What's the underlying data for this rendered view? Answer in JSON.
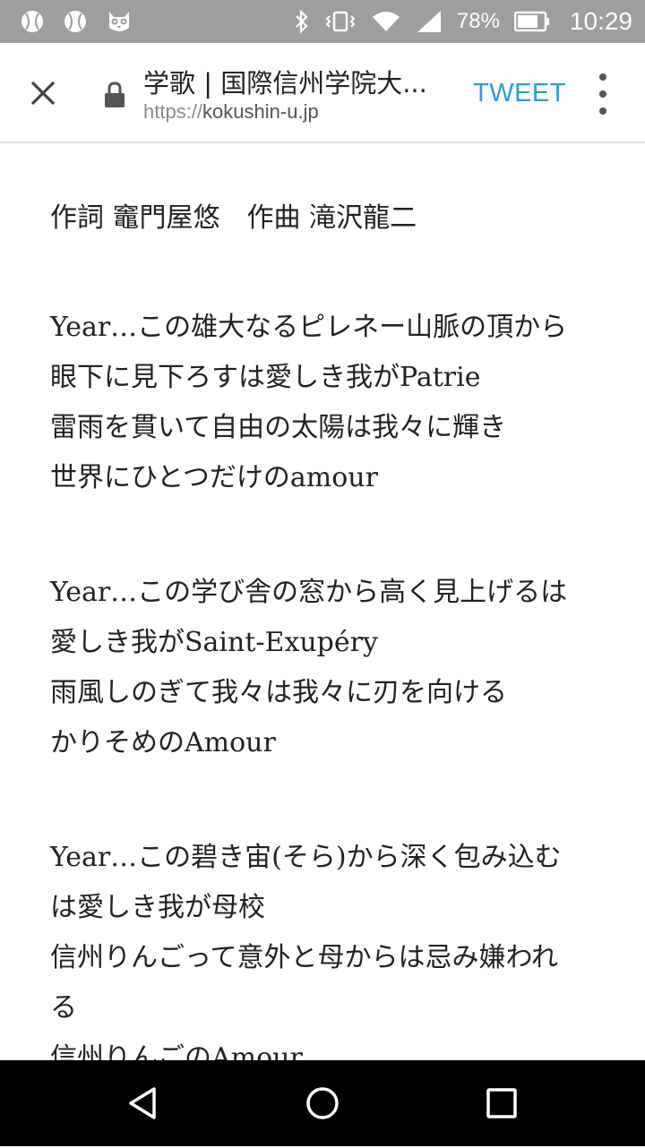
{
  "status_bar": {
    "battery_percent": "78%",
    "time": "10:29",
    "left_icons": [
      "baseball-icon",
      "baseball-icon",
      "owl-icon"
    ],
    "right_icons": [
      "bluetooth-icon",
      "vibrate-icon",
      "wifi-icon",
      "signal-icon",
      "battery-icon"
    ]
  },
  "toolbar": {
    "title": "学歌 | 国際信州学院大...",
    "url_scheme": "https://",
    "url_host": "kokushin-u.jp",
    "tweet_label": "TWEET"
  },
  "content": {
    "credit": "作詞 竈門屋悠　作曲 滝沢龍二",
    "stanzas": [
      {
        "lines": [
          "Year…この雄大なるピレネー山脈の頂から",
          "眼下に見下ろすは愛しき我がPatrie",
          "雷雨を貫いて自由の太陽は我々に輝き",
          "世界にひとつだけのamour"
        ]
      },
      {
        "lines": [
          "Year…この学び舎の窓から高く見上げるは",
          "愛しき我がSaint-Exupéry",
          "雨風しのぎて我々は我々に刃を向ける",
          "かりそめのAmour"
        ]
      },
      {
        "lines": [
          "Year…この碧き宙(そら)から深く包み込む",
          "は愛しき我が母校",
          "信州りんごって意外と母からは忌み嫌われ",
          "る",
          "信州りんごのAmour"
        ]
      }
    ]
  },
  "nav_bar": {
    "buttons": [
      "back-icon",
      "home-icon",
      "recents-icon"
    ]
  }
}
